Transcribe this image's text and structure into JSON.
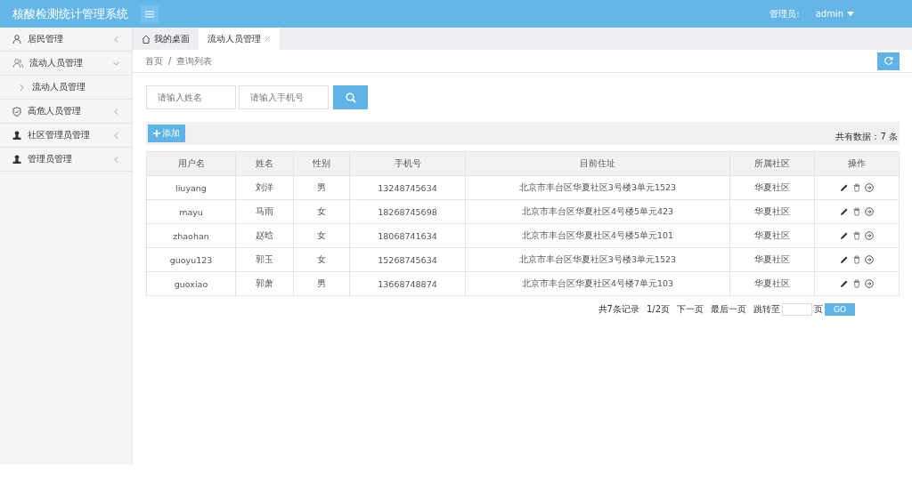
{
  "header": {
    "title": "核酸检测统计管理系统",
    "user_label": "管理员:",
    "user_name": "admin"
  },
  "sidebar": {
    "items": [
      {
        "label": "居民管理",
        "expanded": false
      },
      {
        "label": "流动人员管理",
        "expanded": true,
        "children": [
          {
            "label": "流动人员管理"
          }
        ]
      },
      {
        "label": "高危人员管理",
        "expanded": false
      },
      {
        "label": "社区管理员管理",
        "expanded": false
      },
      {
        "label": "管理员管理",
        "expanded": false
      }
    ]
  },
  "tabs": [
    {
      "label": "我的桌面",
      "selected": false
    },
    {
      "label": "流动人员管理",
      "selected": true
    }
  ],
  "breadcrumb": [
    "首页",
    "/",
    "查询列表"
  ],
  "search": {
    "fields": [
      {
        "placeholder": "请输入姓名"
      },
      {
        "placeholder": "请输入手机号"
      }
    ]
  },
  "toolbar": {
    "add_button": "添加",
    "total": "共有数据：7 条"
  },
  "table": {
    "columns": [
      "用户名",
      "姓名",
      "性别",
      "手机号",
      "目前住址",
      "所属社区",
      "操作"
    ],
    "rows": [
      [
        "liuyang",
        "刘洋",
        "男",
        "13248745634",
        "北京市丰台区华夏社区3号楼3单元1523",
        "华夏社区"
      ],
      [
        "mayu",
        "马雨",
        "女",
        "18268745698",
        "北京市丰台区华夏社区4号楼5单元423",
        "华夏社区"
      ],
      [
        "zhaohan",
        "赵晗",
        "女",
        "18068741634",
        "北京市丰台区华夏社区4号楼5单元101",
        "华夏社区"
      ],
      [
        "guoyu123",
        "郭玉",
        "女",
        "15268745634",
        "北京市丰台区华夏社区3号楼3单元1523",
        "华夏社区"
      ],
      [
        "guoxiao",
        "郭萧",
        "男",
        "13668748874",
        "北京市丰台区华夏社区4号楼7单元103",
        "华夏社区"
      ]
    ]
  },
  "pagination": {
    "records": "共7条记录",
    "page": "1/2页",
    "next": "下一页",
    "last": "最后一页",
    "jump_label": "跳转至",
    "page_unit": "页",
    "go": "GO"
  }
}
